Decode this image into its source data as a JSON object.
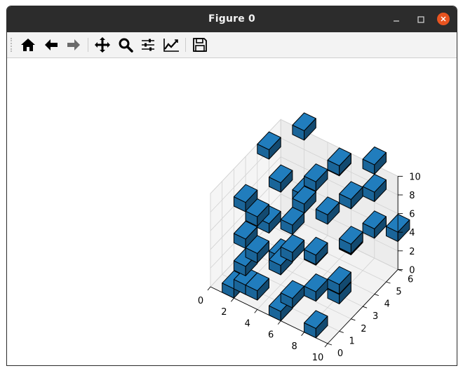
{
  "window": {
    "title": "Figure 0"
  },
  "toolbar": {
    "buttons": [
      {
        "name": "home-button",
        "icon": "home-icon",
        "tooltip": "Reset original view"
      },
      {
        "name": "back-button",
        "icon": "arrow-left-icon",
        "tooltip": "Back to previous view"
      },
      {
        "name": "forward-button",
        "icon": "arrow-right-icon",
        "tooltip": "Forward to next view"
      },
      {
        "name": "pan-button",
        "icon": "move-icon",
        "tooltip": "Pan axes"
      },
      {
        "name": "zoom-button",
        "icon": "magnifier-icon",
        "tooltip": "Zoom to rectangle"
      },
      {
        "name": "subplots-button",
        "icon": "sliders-icon",
        "tooltip": "Configure subplots"
      },
      {
        "name": "customize-button",
        "icon": "line-chart-icon",
        "tooltip": "Edit axis, curve and image parameters"
      },
      {
        "name": "save-button",
        "icon": "floppy-disk-icon",
        "tooltip": "Save the figure"
      }
    ]
  },
  "chart_data": {
    "type": "3d-voxels",
    "title": "",
    "xlabel": "",
    "ylabel": "",
    "zlabel": "",
    "xlim": [
      0,
      10
    ],
    "ylim": [
      0,
      6
    ],
    "zlim": [
      0,
      10
    ],
    "x_ticks": [
      "0",
      "2",
      "4",
      "6",
      "8",
      "10"
    ],
    "y_ticks": [
      "0",
      "1",
      "2",
      "3",
      "4",
      "5",
      "6"
    ],
    "z_ticks": [
      "0",
      "2",
      "4",
      "6",
      "8",
      "10"
    ],
    "grid": true,
    "voxel_color": "#1f77b4",
    "edge_color": "#000000",
    "voxels": [
      [
        1,
        0,
        0
      ],
      [
        2,
        0,
        1
      ],
      [
        2,
        0,
        3
      ],
      [
        3,
        0,
        1
      ],
      [
        3,
        0,
        5
      ],
      [
        5,
        0,
        0
      ],
      [
        6,
        0,
        2
      ],
      [
        8,
        0,
        0
      ],
      [
        1,
        1,
        4
      ],
      [
        2,
        1,
        7
      ],
      [
        4,
        1,
        3
      ],
      [
        5,
        1,
        5
      ],
      [
        7,
        1,
        2
      ],
      [
        9,
        1,
        4
      ],
      [
        0,
        2,
        6
      ],
      [
        3,
        2,
        2
      ],
      [
        4,
        2,
        6
      ],
      [
        6,
        2,
        4
      ],
      [
        8,
        2,
        1
      ],
      [
        9,
        2,
        7
      ],
      [
        1,
        3,
        3
      ],
      [
        2,
        3,
        8
      ],
      [
        5,
        3,
        2
      ],
      [
        6,
        3,
        7
      ],
      [
        8,
        3,
        5
      ],
      [
        0,
        4,
        9
      ],
      [
        3,
        4,
        5
      ],
      [
        4,
        4,
        8
      ],
      [
        7,
        4,
        3
      ],
      [
        9,
        4,
        6
      ],
      [
        2,
        5,
        4
      ],
      [
        5,
        5,
        9
      ],
      [
        6,
        5,
        6
      ],
      [
        8,
        5,
        8
      ],
      [
        1,
        6,
        9
      ],
      [
        4,
        6,
        7
      ],
      [
        7,
        6,
        9
      ],
      [
        9,
        6,
        3
      ]
    ]
  }
}
